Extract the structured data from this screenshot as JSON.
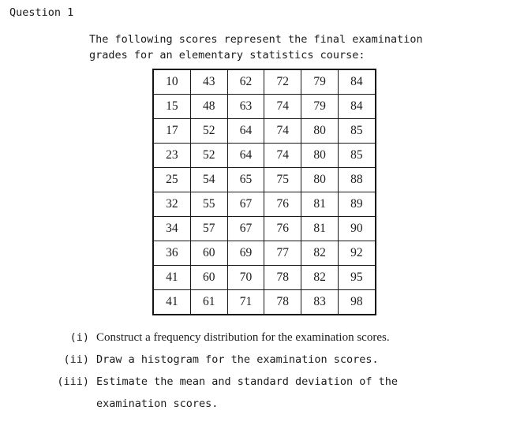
{
  "heading": "Question 1",
  "intro": {
    "line1": "The following scores represent the final examination",
    "line2": "grades for an elementary statistics course:"
  },
  "scores_table": {
    "rows": [
      [
        "10",
        "43",
        "62",
        "72",
        "79",
        "84"
      ],
      [
        "15",
        "48",
        "63",
        "74",
        "79",
        "84"
      ],
      [
        "17",
        "52",
        "64",
        "74",
        "80",
        "85"
      ],
      [
        "23",
        "52",
        "64",
        "74",
        "80",
        "85"
      ],
      [
        "25",
        "54",
        "65",
        "75",
        "80",
        "88"
      ],
      [
        "32",
        "55",
        "67",
        "76",
        "81",
        "89"
      ],
      [
        "34",
        "57",
        "67",
        "76",
        "81",
        "90"
      ],
      [
        "36",
        "60",
        "69",
        "77",
        "82",
        "92"
      ],
      [
        "41",
        "60",
        "70",
        "78",
        "82",
        "95"
      ],
      [
        "41",
        "61",
        "71",
        "78",
        "83",
        "98"
      ]
    ]
  },
  "subquestions": [
    {
      "label": "(i)",
      "text": "Construct a frequency distribution for the examination scores.",
      "continuation": ""
    },
    {
      "label": "(ii)",
      "text": "Draw a histogram for the examination scores.",
      "continuation": ""
    },
    {
      "label": "(iii)",
      "text": "Estimate the mean and standard deviation of the",
      "continuation": "examination scores."
    }
  ],
  "colors": {
    "text": "#1b1b1b",
    "table_border": "#141414",
    "background": "#ffffff"
  }
}
